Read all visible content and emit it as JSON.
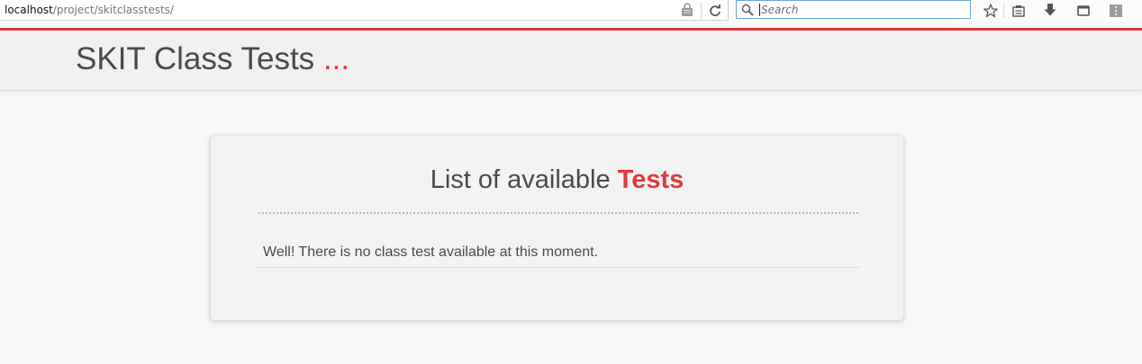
{
  "browser": {
    "url_host": "localhost",
    "url_path": "/project/skitclasstests/",
    "search_placeholder": "Search",
    "accent_color": "#e0393e"
  },
  "header": {
    "title": "SKIT Class Tests",
    "title_suffix": "..."
  },
  "card": {
    "heading_prefix": "List of available",
    "heading_accent": "Tests",
    "message": "Well! There is no class test available at this moment."
  }
}
